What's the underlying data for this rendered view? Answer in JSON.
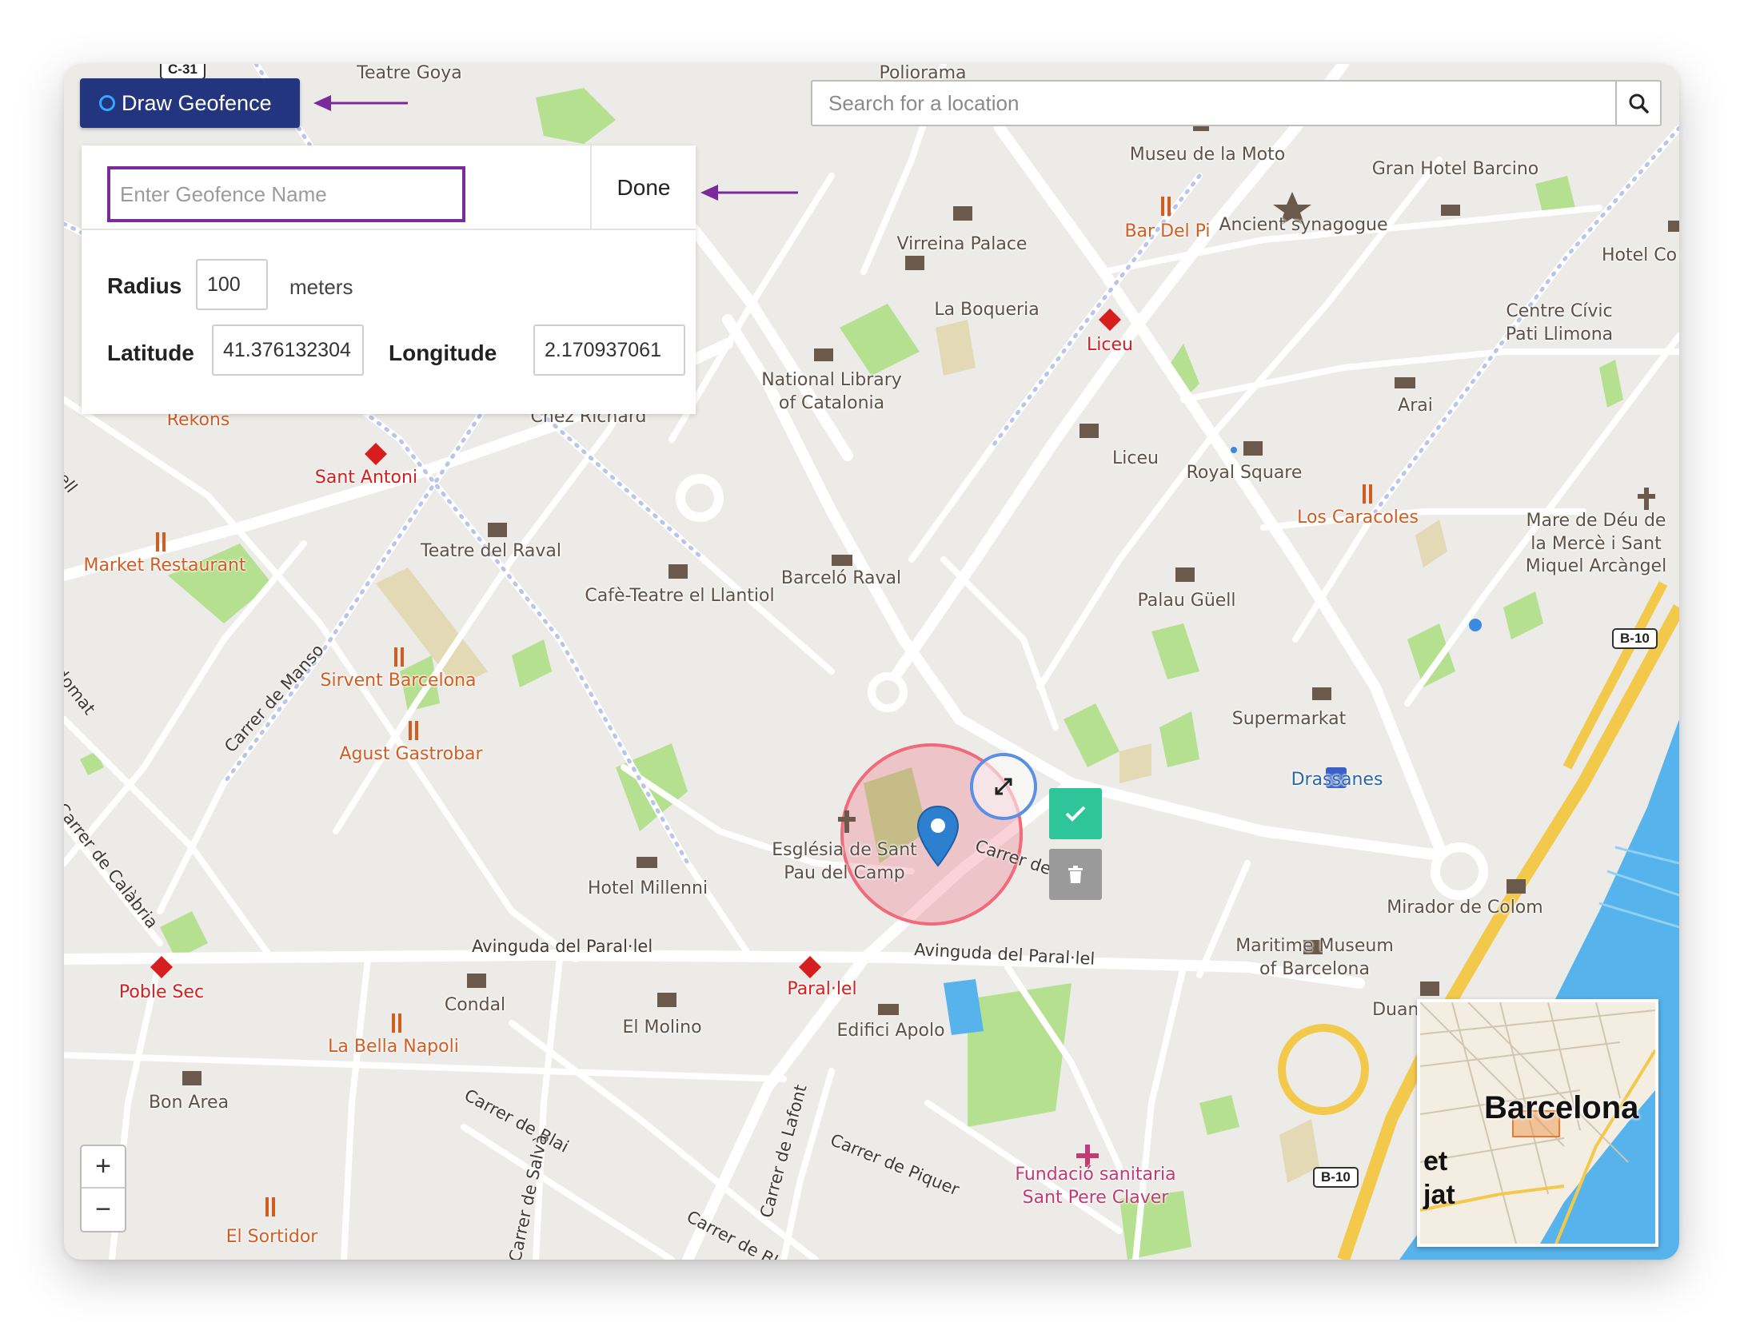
{
  "toolbar": {
    "draw_button_label": "Draw Geofence"
  },
  "geofence_panel": {
    "name_placeholder": "Enter Geofence Name",
    "done_label": "Done",
    "radius_label": "Radius",
    "radius_value": "100",
    "radius_unit": "meters",
    "latitude_label": "Latitude",
    "latitude_value": "41.376132304",
    "longitude_label": "Longitude",
    "longitude_value": "2.170937061"
  },
  "search": {
    "placeholder": "Search for a location"
  },
  "zoom": {
    "in_label": "+",
    "out_label": "−"
  },
  "minimap": {
    "title": "Barcelona",
    "sub1": "et",
    "sub2": "jat"
  },
  "map_labels": {
    "teatre_goya": "Teatre Goya",
    "poliorama": "Poliorama",
    "museu_moto": "Museu de la Moto",
    "gran_hotel": "Gran Hotel Barcino",
    "hotel_co": "Hotel Co",
    "bar_del_pi": "Bar Del Pi",
    "ancient_synagogue": "Ancient synagogue",
    "virreina": "Virreina Palace",
    "boqueria": "La Boqueria",
    "centre_civic": "Centre Cívic\nPati Llimona",
    "liceu_metro": "Liceu",
    "national_library": "National Library\nof Catalonia",
    "arai": "Arai",
    "rekons": "Rekons",
    "chez_richard": "Chez Richard",
    "sant_antoni": "Sant Antoni",
    "liceu": "Liceu",
    "royal_square": "Royal Square",
    "los_caracoles": "Los Caracoles",
    "mare_de_deu": "Mare de Déu de\nla Mercè i Sant\nMiquel Arcàngel",
    "market_restaurant": "Market Restaurant",
    "teatre_raval": "Teatre del Raval",
    "barcelo_raval": "Barceló Raval",
    "cafe_teatre": "Cafè-Teatre el Llantiol",
    "palau_guell": "Palau Güell",
    "sirvent": "Sirvent Barcelona",
    "agust": "Agust Gastrobar",
    "supermarkat": "Supermarkat",
    "drassanes": "Drassanes",
    "esglesia": "Església de Sant\nPau del Camp",
    "hotel_millenni": "Hotel Millenni",
    "mirador": "Mirador de Colom",
    "maritime": "Maritime Museum\nof Barcelona",
    "poble_sec": "Poble Sec",
    "condal": "Condal",
    "paral_lel": "Paral·lel",
    "el_molino": "El Molino",
    "edifici_apolo": "Edifici Apolo",
    "duana": "Duana",
    "la_bella_napoli": "La Bella Napoli",
    "bon_area": "Bon Area",
    "fundacio": "Fundació sanitaria\nSant Pere Claver",
    "el_sortidor": "El Sortidor",
    "carrer_de_partial": "Carrer de"
  },
  "street_labels": {
    "carrer_manso": "Carrer de Manso",
    "avinguda_1": "Avinguda del Paral·lel",
    "avinguda_2": "Avinguda del Paral·lel",
    "carrer_blai": "Carrer de Blai",
    "carrer_lafont": "Carrer de Lafont",
    "carrer_piquer": "Carrer de Piquer",
    "carrer_salva": "Carrer de Salvà",
    "carrer_calabria": "Carrer de Calàbria",
    "carrer_ble": "Carrer de Ble",
    "dromat": "ndomat",
    "rrell": "rrell"
  },
  "road_shields": {
    "c31": "C-31",
    "b10_right": "B-10",
    "b10_bottom": "B-10"
  },
  "colors": {
    "accent": "#24357f",
    "name_input_border": "#7a2a9a",
    "annotation_arrow": "#7a2a9a",
    "geofence_circle": "#f06a7a",
    "confirm": "#2fc59a",
    "marker": "#2d7fd0"
  },
  "icons": {
    "search": "search-icon",
    "confirm": "check-icon",
    "delete": "trash-icon",
    "resize": "resize-icon",
    "marker": "map-pin-icon"
  }
}
